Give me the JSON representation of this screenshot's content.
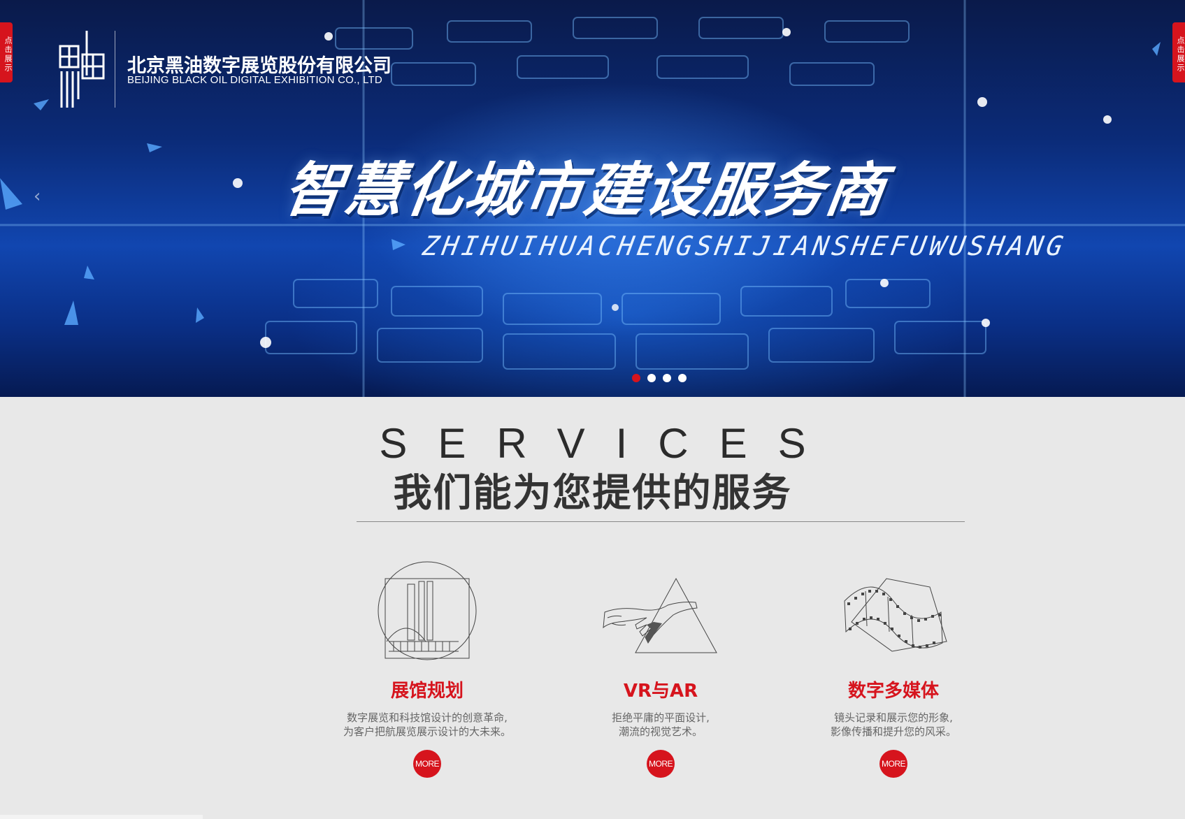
{
  "side_tabs": {
    "left": "点击展示",
    "right": "点击展示"
  },
  "logo": {
    "company_cn": "北京黑油数字展览股份有限公司",
    "company_en": "BEIJING BLACK OIL DIGITAL EXHIBITION CO., LTD"
  },
  "banner": {
    "headline": "智慧化城市建设服务商",
    "pinyin": "ZHIHUIHUACHENGSHIJIANSHEFUWUSHANG",
    "prev_arrow": "‹",
    "slides_count": 4,
    "active_slide": 1
  },
  "services": {
    "title_en": "SERVICES",
    "title_cn": "我们能为您提供的服务",
    "items": [
      {
        "name": "展馆规划",
        "desc_line1": "数字展览和科技馆设计的创意革命,",
        "desc_line2": "为客户把航展览展示设计的大未来。",
        "more": "MORE",
        "icon": "exhibition-hall-icon"
      },
      {
        "name": "VR与AR",
        "desc_line1": "拒绝平庸的平面设计,",
        "desc_line2": "潮流的视觉艺术。",
        "more": "MORE",
        "icon": "hand-triangle-icon"
      },
      {
        "name": "数字多媒体",
        "desc_line1": "镜头记录和展示您的形象,",
        "desc_line2": "影像传播和提升您的风采。",
        "more": "MORE",
        "icon": "film-strip-icon"
      }
    ]
  },
  "colors": {
    "accent": "#d6141d",
    "banner_blue": "#1146b0",
    "page_bg": "#e8e8e8"
  }
}
